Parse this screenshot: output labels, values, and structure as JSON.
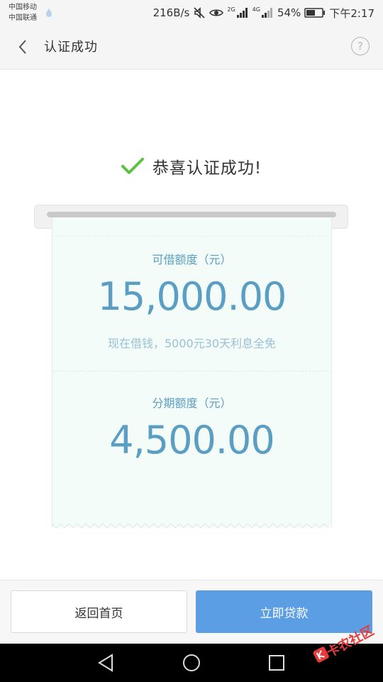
{
  "status_bar": {
    "carrier_1": "中国移动",
    "carrier_2": "中国联通",
    "net_speed": "216B/s",
    "net_2g": "2G",
    "net_4g": "4G",
    "battery": "54%",
    "time": "下午2:17"
  },
  "header": {
    "title": "认证成功",
    "help_symbol": "?"
  },
  "success": {
    "message": "恭喜认证成功!"
  },
  "receipt": {
    "borrow_label": "可借额度（元）",
    "borrow_amount": "15,000.00",
    "borrow_note": "现在借钱，5000元30天利息全免",
    "installment_label": "分期额度（元）",
    "installment_amount": "4,500.00"
  },
  "buttons": {
    "home": "返回首页",
    "loan": "立即贷款"
  },
  "watermark": {
    "text": "卡农社区"
  },
  "colors": {
    "accent_blue": "#5b9ee4",
    "amount_blue": "#5a9ec3",
    "check_green": "#5cc13d",
    "watermark_red": "#e83a3a"
  }
}
